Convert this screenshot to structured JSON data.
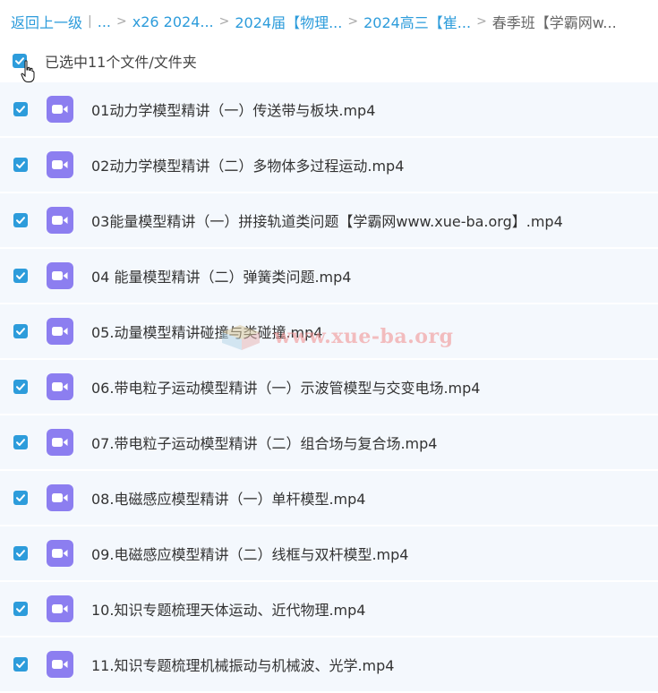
{
  "breadcrumb": {
    "back": "返回上一级",
    "ellipsis": "...",
    "items": [
      "x26 2024...",
      "2024届【物理...",
      "2024高三【崔...",
      "春季班【学霸网w..."
    ]
  },
  "selection": {
    "label": "已选中11个文件/文件夹",
    "checked": true
  },
  "files": [
    {
      "name": "01动力学模型精讲（一）传送带与板块.mp4",
      "checked": true
    },
    {
      "name": "02动力学模型精讲（二）多物体多过程运动.mp4",
      "checked": true
    },
    {
      "name": "03能量模型精讲（一）拼接轨道类问题【学霸网www.xue-ba.org】.mp4",
      "checked": true
    },
    {
      "name": "04 能量模型精讲（二）弹簧类问题.mp4",
      "checked": true
    },
    {
      "name": "05.动量模型精讲碰撞与类碰撞.mp4",
      "checked": true
    },
    {
      "name": "06.带电粒子运动模型精讲（一）示波管模型与交变电场.mp4",
      "checked": true
    },
    {
      "name": "07.带电粒子运动模型精讲（二）组合场与复合场.mp4",
      "checked": true
    },
    {
      "name": "08.电磁感应模型精讲（一）单杆模型.mp4",
      "checked": true
    },
    {
      "name": "09.电磁感应模型精讲（二）线框与双杆模型.mp4",
      "checked": true
    },
    {
      "name": "10.知识专题梳理天体运动、近代物理.mp4",
      "checked": true
    },
    {
      "name": "11.知识专题梳理机械振动与机械波、光学.mp4",
      "checked": true
    }
  ],
  "watermark": {
    "text": "www.xue-ba.org"
  },
  "icons": {
    "file": "video-file-icon",
    "check": "checkmark-icon",
    "cursor": "hand-cursor-icon"
  },
  "colors": {
    "accent": "#2d9cdb",
    "video_icon": "#8c7ef0",
    "row_bg": "#f4f8fd"
  }
}
